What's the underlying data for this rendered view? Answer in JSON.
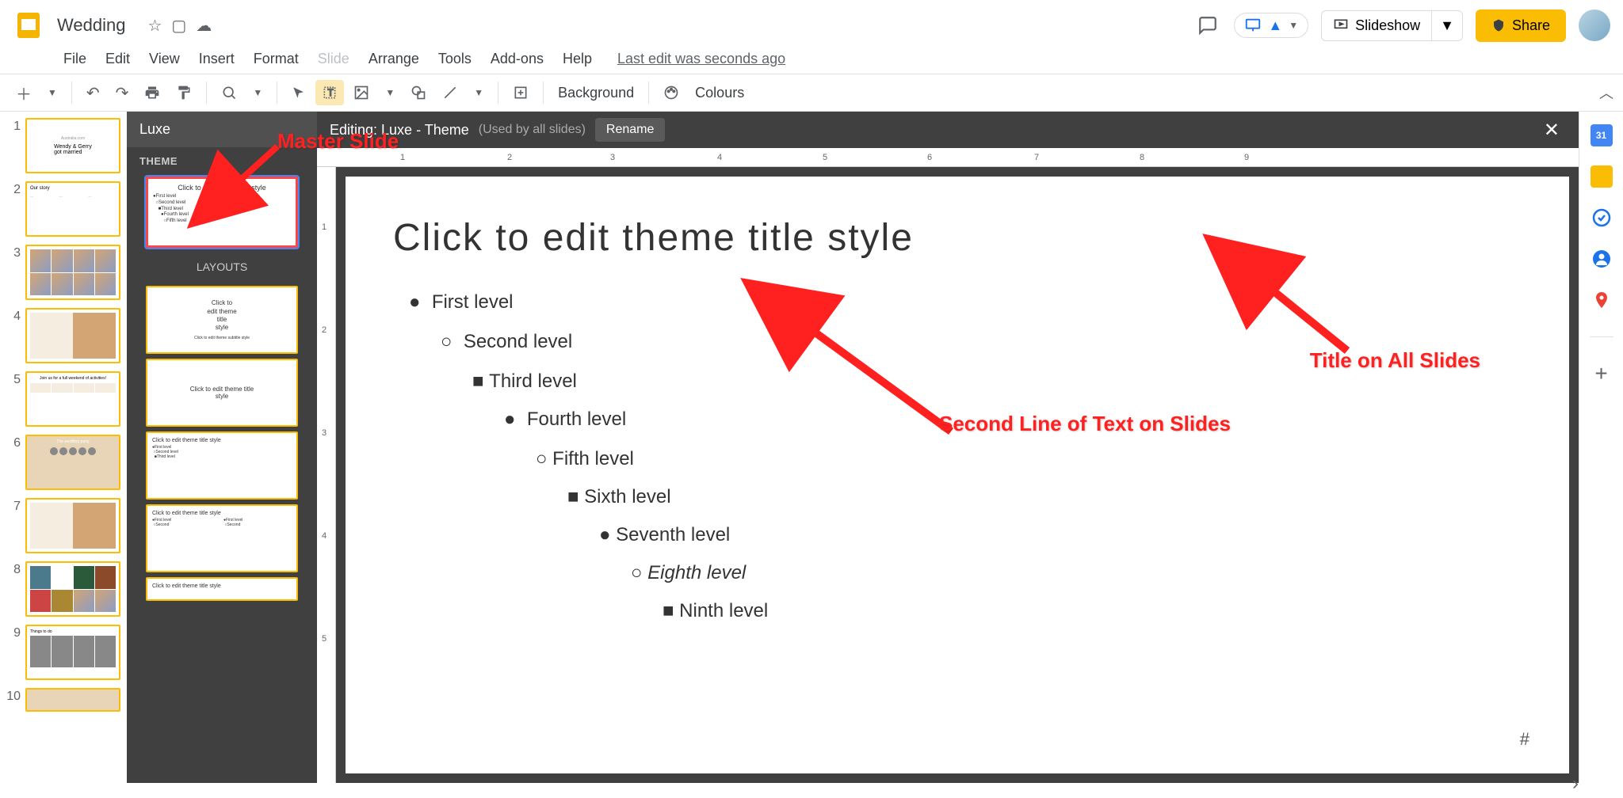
{
  "doc": {
    "title": "Wedding",
    "last_edit": "Last edit was seconds ago"
  },
  "menu": {
    "file": "File",
    "edit": "Edit",
    "view": "View",
    "insert": "Insert",
    "format": "Format",
    "slide": "Slide",
    "arrange": "Arrange",
    "tools": "Tools",
    "addons": "Add-ons",
    "help": "Help"
  },
  "header": {
    "slideshow": "Slideshow",
    "share": "Share"
  },
  "toolbar": {
    "background": "Background",
    "colours": "Colours"
  },
  "master": {
    "theme_name": "Luxe",
    "theme_label": "THEME",
    "layouts_label": "LAYOUTS",
    "editing": "Editing: Luxe - Theme",
    "used_by": "(Used by all slides)",
    "rename": "Rename",
    "thumb_title": "Click to edit theme title style",
    "thumb_title_wrap": "Click to edit theme title style"
  },
  "canvas": {
    "title": "Click to edit theme title style",
    "levels": [
      "First level",
      "Second level",
      "Third level",
      "Fourth level",
      "Fifth level",
      "Sixth level",
      "Seventh level",
      "Eighth level",
      "Ninth level"
    ],
    "page_marker": "#"
  },
  "annotations": {
    "master_slide": "Master Slide",
    "title_all": "Title on All Slides",
    "second_line": "Second Line of Text on Slides"
  },
  "slides": [
    1,
    2,
    3,
    4,
    5,
    6,
    7,
    8,
    9,
    10
  ],
  "ruler_h": [
    1,
    2,
    3,
    4,
    5,
    6,
    7,
    8,
    9
  ],
  "ruler_v": [
    1,
    2,
    3,
    4,
    5
  ]
}
